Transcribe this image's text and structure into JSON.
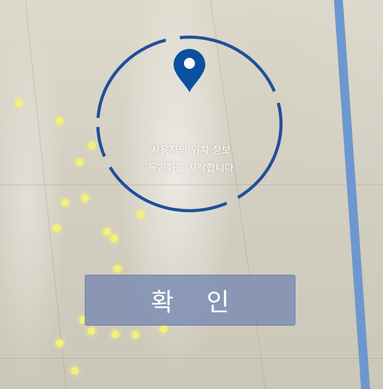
{
  "sync": {
    "message_line1": "사용자의 위치 정보",
    "message_line2": "동기화를 시작합니다",
    "icon": "location-pin-icon",
    "ring_color": "#1f4f9a",
    "pin_color": "#0b4fa0"
  },
  "confirm_button": {
    "label": "확 인",
    "background_color": "#7a8ab2"
  },
  "floor_tape_color": "#6e97cf",
  "feature_point_color": "#f4f07a"
}
